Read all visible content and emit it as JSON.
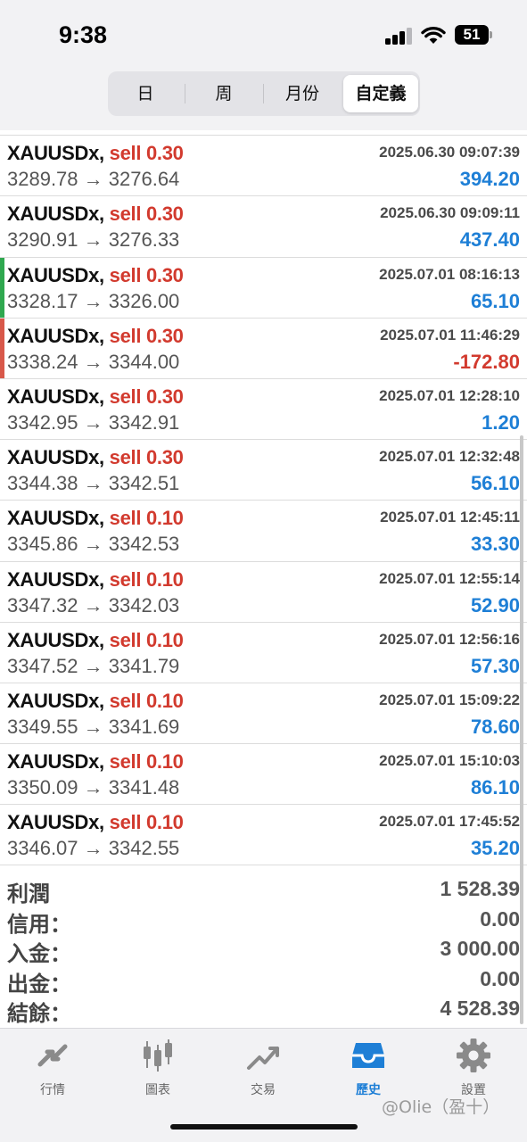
{
  "status": {
    "time": "9:38",
    "battery": "51"
  },
  "tabs": [
    {
      "label": "日"
    },
    {
      "label": "周"
    },
    {
      "label": "月份"
    },
    {
      "label": "自定義"
    }
  ],
  "trades": [
    {
      "symbol": "XAUUSDx,",
      "direction": "sell",
      "volume": "0.30",
      "time": "2025.06.30 09:07:39",
      "open": "3289.78",
      "close": "3276.64",
      "profit": "394.20"
    },
    {
      "symbol": "XAUUSDx,",
      "direction": "sell",
      "volume": "0.30",
      "time": "2025.06.30 09:09:11",
      "open": "3290.91",
      "close": "3276.33",
      "profit": "437.40"
    },
    {
      "symbol": "XAUUSDx,",
      "direction": "sell",
      "volume": "0.30",
      "time": "2025.07.01 08:16:13",
      "open": "3328.17",
      "close": "3326.00",
      "profit": "65.10"
    },
    {
      "symbol": "XAUUSDx,",
      "direction": "sell",
      "volume": "0.30",
      "time": "2025.07.01 11:46:29",
      "open": "3338.24",
      "close": "3344.00",
      "profit": "-172.80"
    },
    {
      "symbol": "XAUUSDx,",
      "direction": "sell",
      "volume": "0.30",
      "time": "2025.07.01 12:28:10",
      "open": "3342.95",
      "close": "3342.91",
      "profit": "1.20"
    },
    {
      "symbol": "XAUUSDx,",
      "direction": "sell",
      "volume": "0.30",
      "time": "2025.07.01 12:32:48",
      "open": "3344.38",
      "close": "3342.51",
      "profit": "56.10"
    },
    {
      "symbol": "XAUUSDx,",
      "direction": "sell",
      "volume": "0.10",
      "time": "2025.07.01 12:45:11",
      "open": "3345.86",
      "close": "3342.53",
      "profit": "33.30"
    },
    {
      "symbol": "XAUUSDx,",
      "direction": "sell",
      "volume": "0.10",
      "time": "2025.07.01 12:55:14",
      "open": "3347.32",
      "close": "3342.03",
      "profit": "52.90"
    },
    {
      "symbol": "XAUUSDx,",
      "direction": "sell",
      "volume": "0.10",
      "time": "2025.07.01 12:56:16",
      "open": "3347.52",
      "close": "3341.79",
      "profit": "57.30"
    },
    {
      "symbol": "XAUUSDx,",
      "direction": "sell",
      "volume": "0.10",
      "time": "2025.07.01 15:09:22",
      "open": "3349.55",
      "close": "3341.69",
      "profit": "78.60"
    },
    {
      "symbol": "XAUUSDx,",
      "direction": "sell",
      "volume": "0.10",
      "time": "2025.07.01 15:10:03",
      "open": "3350.09",
      "close": "3341.48",
      "profit": "86.10"
    },
    {
      "symbol": "XAUUSDx,",
      "direction": "sell",
      "volume": "0.10",
      "time": "2025.07.01 17:45:52",
      "open": "3346.07",
      "close": "3342.55",
      "profit": "35.20"
    }
  ],
  "summary": [
    {
      "label": "利潤",
      "value": "1 528.39"
    },
    {
      "label": "信用：",
      "value": "0.00"
    },
    {
      "label": "入金：",
      "value": "3 000.00"
    },
    {
      "label": "出金：",
      "value": "0.00"
    },
    {
      "label": "結餘：",
      "value": "4 528.39"
    }
  ],
  "bottom_nav": [
    {
      "label": "行情",
      "icon": "quotes-icon"
    },
    {
      "label": "圖表",
      "icon": "chart-icon"
    },
    {
      "label": "交易",
      "icon": "trade-icon"
    },
    {
      "label": "歷史",
      "icon": "history-icon"
    },
    {
      "label": "設置",
      "icon": "settings-icon"
    }
  ],
  "watermark": "@Olie（盈十）",
  "colors": {
    "accent": "#1e7fd6",
    "sell": "#d23a2e",
    "profit_marker": "#2fa84f",
    "loss_marker": "#d8584a"
  }
}
